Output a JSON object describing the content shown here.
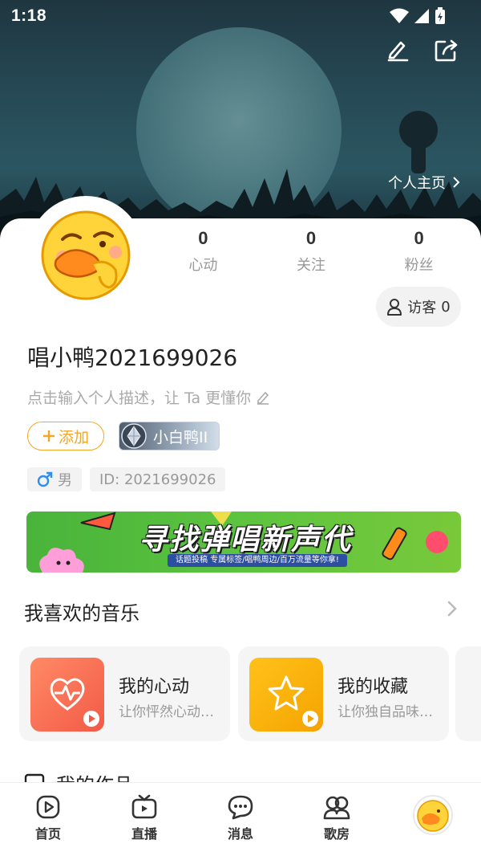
{
  "status_bar": {
    "time": "1:18"
  },
  "header": {
    "homepage_link": "个人主页"
  },
  "stats": [
    {
      "value": "0",
      "label": "心动"
    },
    {
      "value": "0",
      "label": "关注"
    },
    {
      "value": "0",
      "label": "粉丝"
    }
  ],
  "visitors": {
    "label": "访客",
    "count": "0"
  },
  "profile": {
    "username": "唱小鸭2021699026",
    "bio_placeholder": "点击输入个人描述，让 Ta 更懂你",
    "add_tag_label": "添加",
    "level_badge": "小白鸭II",
    "gender": "男",
    "id_label": "ID: 2021699026"
  },
  "banner": {
    "title": "寻找弹唱新声代",
    "subtitle": "话题投稿 专属标签/唱鸭周边/百万流量等你拿!"
  },
  "music_section": {
    "title": "我喜欢的音乐",
    "cards": [
      {
        "title": "我的心动",
        "subtitle": "让你怦然心动…",
        "color": "#f76b4f"
      },
      {
        "title": "我的收藏",
        "subtitle": "让你独自品味…",
        "color": "#f7b400"
      }
    ]
  },
  "works_section": {
    "title": "我的作品"
  },
  "bottom_nav": [
    {
      "label": "首页",
      "icon": "play-circle-icon"
    },
    {
      "label": "直播",
      "icon": "tv-icon"
    },
    {
      "label": "消息",
      "icon": "chat-bubble-icon"
    },
    {
      "label": "歌房",
      "icon": "people-icon"
    },
    {
      "label": "",
      "icon": "profile-avatar-icon"
    }
  ]
}
